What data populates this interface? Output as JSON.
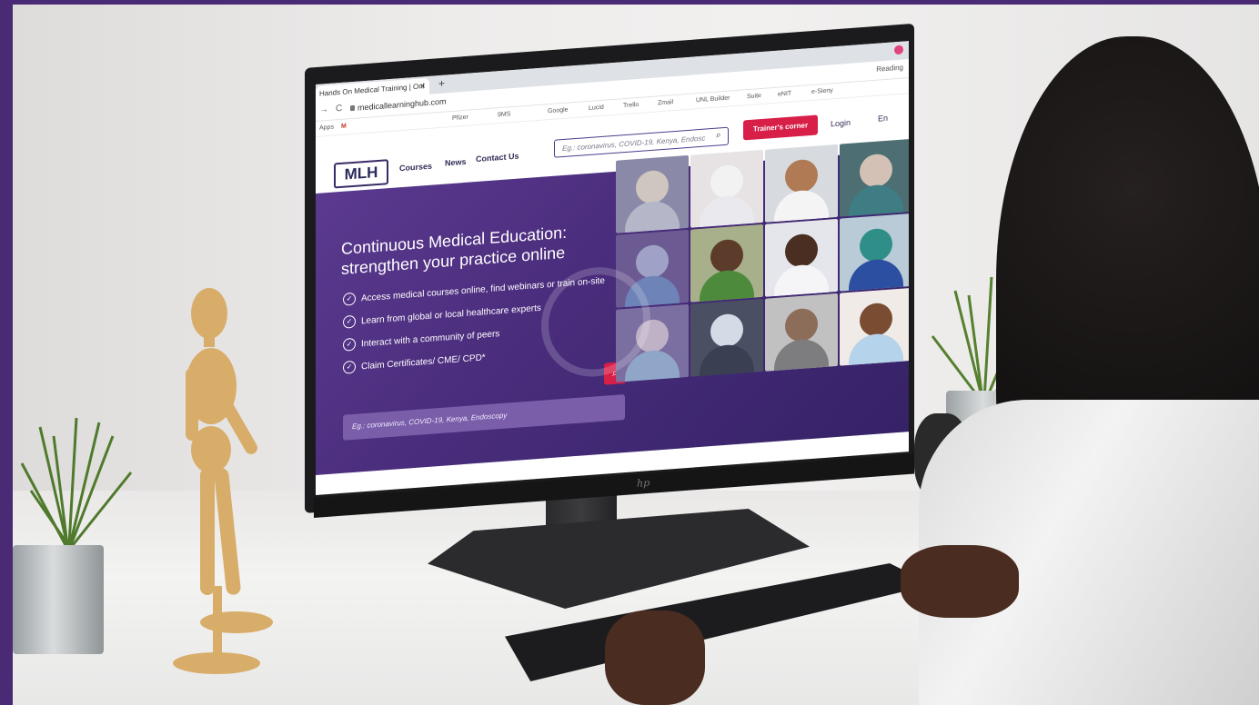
{
  "browser": {
    "tab_title": "Hands On Medical Training | Onl",
    "tab_close": "✕",
    "new_tab": "+",
    "url": "medicallearninghub.com",
    "bookmarks": [
      "Apps",
      "M",
      "Pfizer",
      "9MS",
      "Google",
      "Lucid",
      "Trello",
      "Zmail",
      "UNL Builder",
      "Suite",
      "eNIT",
      "e-Sieny"
    ],
    "reading_list": "Reading"
  },
  "site": {
    "logo": "MLH",
    "nav": {
      "courses": "Courses",
      "news": "News",
      "contact": "Contact Us"
    },
    "search_placeholder": "Eg.: coronavirus, COVID-19, Kenya, Endosc",
    "trainer_button": "Trainer's corner",
    "login": "Login",
    "language": "En"
  },
  "hero": {
    "title_line1": "Continuous Medical Education:",
    "title_line2": "strengthen your practice online",
    "bullets": [
      "Access medical courses online, find webinars or train on-site",
      "Learn from global or local healthcare experts",
      "Interact with a community of peers",
      "Claim Certificates/ CME/ CPD*"
    ],
    "search_placeholder": "Eg.: coronavirus, COVID-19, Kenya, Endoscopy"
  },
  "monitor": {
    "brand": "hp"
  },
  "colors": {
    "frame": "#4a2a74",
    "hero_purple": "#4b2d7d",
    "accent_red": "#d81f48",
    "logo_navy": "#2c2a5a"
  },
  "icons": [
    "search-icon",
    "check-circle-icon",
    "reload-icon",
    "back-arrow-icon",
    "lock-icon"
  ]
}
